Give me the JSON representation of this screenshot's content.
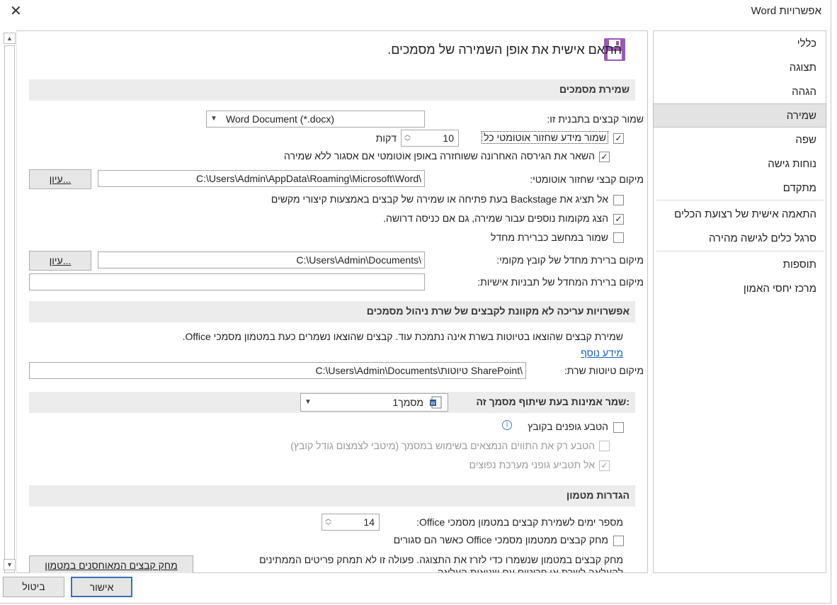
{
  "window": {
    "title": "אפשרויות Word",
    "close_glyph": "✕"
  },
  "nav": {
    "items": [
      {
        "label": "כללי"
      },
      {
        "label": "תצוגה"
      },
      {
        "label": "הגהה"
      },
      {
        "label": "שמירה"
      },
      {
        "label": "שפה"
      },
      {
        "label": "נוחות גישה"
      },
      {
        "label": "מתקדם"
      },
      {
        "label": "התאמה אישית של רצועת הכלים"
      },
      {
        "label": "סרגל כלים לגישה מהירה"
      },
      {
        "label": "תוספות"
      },
      {
        "label": "מרכז יחסי האמון"
      }
    ],
    "active_index": 3
  },
  "header": {
    "title": "התאם אישית את אופן השמירה של מסמכים.",
    "icon": "floppy-disk-icon",
    "accent": "#9b59b6"
  },
  "save_docs": {
    "section_title": "שמירת מסמכים",
    "format_label": "שמור קבצים בתבנית זו:",
    "format_value": "Word Document (*.docx)",
    "autorecover_label": "שמור מידע שחזור אוטומטי כל",
    "autorecover_checked": "✓",
    "autorecover_minutes": "10",
    "minutes_label": "דקות",
    "keep_last_label": "השאר את הגירסה האחרונה ששוחזרה באופן אוטומטי אם אסגור ללא שמירה",
    "keep_last_checked": "✓",
    "autorecover_location_label": "מיקום קבצי שחזור אוטומטי:",
    "autorecover_location_value": "C:\\Users\\Admin\\AppData\\Roaming\\Microsoft\\Word\\",
    "browse_label": "עיון...",
    "no_backstage_label": "אל תציג את Backstage בעת פתיחה או שמירה של קבצים באמצעות קיצורי מקשים",
    "show_extra_locations_label": "הצג מקומות נוספים עבור שמירה, גם אם כניסה דרושה.",
    "show_extra_checked": "✓",
    "save_to_computer_label": "שמור במחשב כברירת מחדל",
    "default_local_label": "מיקום ברירת מחדל של קובץ מקומי:",
    "default_local_value": "C:\\Users\\Admin\\Documents\\",
    "browse2_label": "עיון...",
    "personal_templates_label": "מיקום ברירת המחדל של תבניות אישיות:",
    "personal_templates_value": ""
  },
  "offline": {
    "section_title": "אפשרויות עריכה לא מקוונת לקבצים של שרת ניהול מסמכים",
    "description": "שמירת קבצים שהוצאו בטיוטות בשרת אינה נתמכת עוד. קבצים שהוצאו נשמרים כעת במטמון מסמכי Office.",
    "more_info": "מידע נוסף",
    "drafts_label": "מיקום טיוטות שרת:",
    "drafts_value": "C:\\Users\\Admin\\Documents\\טיוטות SharePoint\\"
  },
  "fidelity": {
    "section_title": "שמר אמינות בעת שיתוף מסמך זה:",
    "document_value": "מסמך1",
    "embed_fonts_label": "הטבע גופנים בקובץ",
    "embed_used_only_label": "הטבע רק את התווים הנמצאים בשימוש במסמך (מיטבי לצמצום גודל קובץ)",
    "no_system_fonts_label": "אל תטביע גופני מערכת נפוצים",
    "no_system_checked": "✓"
  },
  "cache": {
    "section_title": "הגדרות מטמון",
    "days_label": "מספר ימים לשמירת קבצים במטמון מסמכי Office:",
    "days_value": "14",
    "delete_on_close_label": "מחק קבצים ממטמון מסמכי Office כאשר הם סגורים",
    "delete_desc_1": "מחק קבצים במטמון שנשמרו כדי לזרז את התצוגה. פעולה זו לא תמחק פריטים הממתינים",
    "delete_desc_2": "להעלאה לשרת או פריטים עם שגיאות העלאה.",
    "delete_cached_button": "מחק קבצים המאוחסנים במטמון"
  },
  "footer": {
    "ok_label": "אישור",
    "cancel_label": "ביטול"
  }
}
